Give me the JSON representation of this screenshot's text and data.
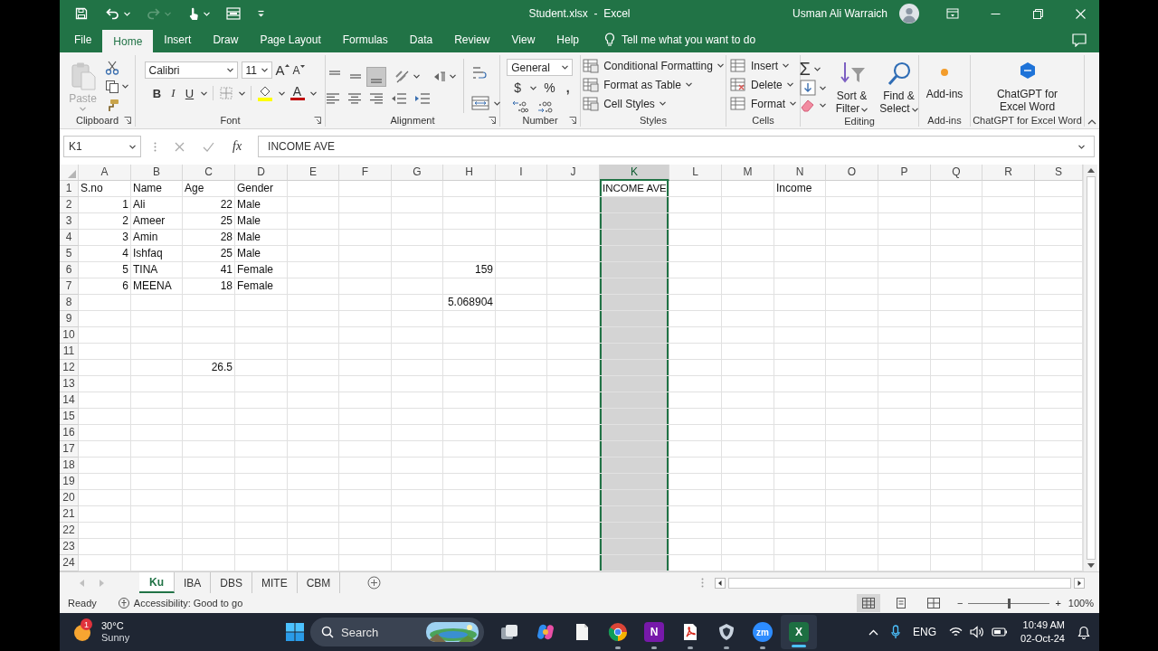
{
  "title_bar": {
    "title": "Student.xlsx  -  Excel",
    "user": "Usman Ali Warraich",
    "redo": {
      "disabled": true
    }
  },
  "ribbon_tabs": [
    {
      "label": "File",
      "selected": false
    },
    {
      "label": "Home",
      "selected": true
    },
    {
      "label": "Insert",
      "selected": false
    },
    {
      "label": "Draw",
      "selected": false
    },
    {
      "label": "Page Layout",
      "selected": false
    },
    {
      "label": "Formulas",
      "selected": false
    },
    {
      "label": "Data",
      "selected": false
    },
    {
      "label": "Review",
      "selected": false
    },
    {
      "label": "View",
      "selected": false
    },
    {
      "label": "Help",
      "selected": false
    }
  ],
  "tell_me": {
    "placeholder": "Tell me what you want to do"
  },
  "ribbon": {
    "groups": [
      {
        "kind": "clipboard",
        "label": "Clipboard",
        "paste": {
          "label": "Paste",
          "disabled": true
        }
      },
      {
        "kind": "font",
        "label": "Font",
        "font_name": "Calibri",
        "font_size": "11",
        "grow": "A",
        "shrink": "A",
        "styles": [
          "B",
          "I",
          "U"
        ],
        "font_color": "A"
      },
      {
        "kind": "alignment",
        "label": "Alignment",
        "align_buttons": [
          {
            "kind": "top",
            "selected": false
          },
          {
            "kind": "middle",
            "selected": false
          },
          {
            "kind": "bottom",
            "selected": true
          }
        ]
      },
      {
        "kind": "number",
        "label": "Number",
        "format": "General",
        "symbols": [
          "$",
          "%",
          ","
        ]
      },
      {
        "kind": "styles",
        "label": "Styles",
        "items": [
          "Conditional Formatting",
          "Format as Table",
          "Cell Styles"
        ]
      },
      {
        "kind": "cells",
        "label": "Cells",
        "items": [
          "Insert",
          "Delete",
          "Format"
        ]
      },
      {
        "kind": "editing",
        "label": "Editing",
        "autosum": "Σ",
        "items": [
          "Sort & Filter",
          "Find & Select"
        ]
      },
      {
        "kind": "addins",
        "label": "Add-ins",
        "button": "Add-ins"
      },
      {
        "kind": "app",
        "label": "ChatGPT for Excel Word",
        "button": "ChatGPT for Excel Word"
      }
    ]
  },
  "formula_bar": {
    "name_box": "K1",
    "function_label": "fx",
    "formula": "INCOME AVE"
  },
  "grid": {
    "columns": [
      {
        "label": "A",
        "selected": false
      },
      {
        "label": "B",
        "selected": false
      },
      {
        "label": "C",
        "selected": false
      },
      {
        "label": "D",
        "selected": false
      },
      {
        "label": "E",
        "selected": false
      },
      {
        "label": "F",
        "selected": false
      },
      {
        "label": "G",
        "selected": false
      },
      {
        "label": "H",
        "selected": false
      },
      {
        "label": "I",
        "selected": false
      },
      {
        "label": "J",
        "selected": false
      },
      {
        "label": "K",
        "selected": true
      },
      {
        "label": "L",
        "selected": false
      },
      {
        "label": "M",
        "selected": false
      },
      {
        "label": "N",
        "selected": false
      },
      {
        "label": "O",
        "selected": false
      },
      {
        "label": "P",
        "selected": false
      },
      {
        "label": "Q",
        "selected": false
      },
      {
        "label": "R",
        "selected": false
      },
      {
        "label": "S",
        "selected": false
      }
    ],
    "rows": [
      {
        "label": "1",
        "cells": {
          "A": {
            "text": "S.no",
            "kind": "text",
            "active": false
          },
          "B": {
            "text": "Name",
            "kind": "text",
            "active": false
          },
          "C": {
            "text": "Age",
            "kind": "text",
            "active": false
          },
          "D": {
            "text": "Gender",
            "kind": "text",
            "active": false
          },
          "K": {
            "text": "INCOME AVE",
            "kind": "text",
            "active": true
          },
          "N": {
            "text": "Income",
            "kind": "text",
            "active": false
          }
        }
      },
      {
        "label": "2",
        "cells": {
          "A": {
            "text": "1",
            "kind": "number",
            "active": false
          },
          "B": {
            "text": "Ali",
            "kind": "text",
            "active": false
          },
          "C": {
            "text": "22",
            "kind": "number",
            "active": false
          },
          "D": {
            "text": "Male",
            "kind": "text",
            "active": false
          }
        }
      },
      {
        "label": "3",
        "cells": {
          "A": {
            "text": "2",
            "kind": "number",
            "active": false
          },
          "B": {
            "text": "Ameer",
            "kind": "text",
            "active": false
          },
          "C": {
            "text": "25",
            "kind": "number",
            "active": false
          },
          "D": {
            "text": "Male",
            "kind": "text",
            "active": false
          }
        }
      },
      {
        "label": "4",
        "cells": {
          "A": {
            "text": "3",
            "kind": "number",
            "active": false
          },
          "B": {
            "text": "Amin",
            "kind": "text",
            "active": false
          },
          "C": {
            "text": "28",
            "kind": "number",
            "active": false
          },
          "D": {
            "text": "Male",
            "kind": "text",
            "active": false
          }
        }
      },
      {
        "label": "5",
        "cells": {
          "A": {
            "text": "4",
            "kind": "number",
            "active": false
          },
          "B": {
            "text": "Ishfaq",
            "kind": "text",
            "active": false
          },
          "C": {
            "text": "25",
            "kind": "number",
            "active": false
          },
          "D": {
            "text": "Male",
            "kind": "text",
            "active": false
          }
        }
      },
      {
        "label": "6",
        "cells": {
          "A": {
            "text": "5",
            "kind": "number",
            "active": false
          },
          "B": {
            "text": "TINA",
            "kind": "text",
            "active": false
          },
          "C": {
            "text": "41",
            "kind": "number",
            "active": false
          },
          "D": {
            "text": "Female",
            "kind": "text",
            "active": false
          },
          "H": {
            "text": "159",
            "kind": "number",
            "active": false
          }
        }
      },
      {
        "label": "7",
        "cells": {
          "A": {
            "text": "6",
            "kind": "number",
            "active": false
          },
          "B": {
            "text": "MEENA",
            "kind": "text",
            "active": false
          },
          "C": {
            "text": "18",
            "kind": "number",
            "active": false
          },
          "D": {
            "text": "Female",
            "kind": "text",
            "active": false
          }
        }
      },
      {
        "label": "8",
        "cells": {
          "H": {
            "text": "5.068904",
            "kind": "number",
            "active": false
          }
        }
      },
      {
        "label": "9"
      },
      {
        "label": "10"
      },
      {
        "label": "11"
      },
      {
        "label": "12",
        "cells": {
          "C": {
            "text": "26.5",
            "kind": "number",
            "active": false
          }
        }
      },
      {
        "label": "13"
      },
      {
        "label": "14"
      },
      {
        "label": "15"
      },
      {
        "label": "16"
      },
      {
        "label": "17"
      },
      {
        "label": "18"
      },
      {
        "label": "19"
      },
      {
        "label": "20"
      },
      {
        "label": "21"
      },
      {
        "label": "22"
      },
      {
        "label": "23"
      },
      {
        "label": "24"
      }
    ]
  },
  "sheet_tabs": [
    {
      "label": "Ku",
      "selected": true
    },
    {
      "label": "IBA",
      "selected": false
    },
    {
      "label": "DBS",
      "selected": false
    },
    {
      "label": "MITE",
      "selected": false
    },
    {
      "label": "CBM",
      "selected": false
    }
  ],
  "status_bar": {
    "mode": "Ready",
    "accessibility": "Accessibility: Good to go",
    "views": [
      {
        "kind": "normal",
        "selected": true
      },
      {
        "kind": "page_layout",
        "selected": false
      },
      {
        "kind": "page_break",
        "selected": false
      }
    ],
    "zoom": {
      "minus": "−",
      "plus": "+",
      "level": 0.5,
      "reading": "100%"
    }
  },
  "taskbar": {
    "weather": {
      "temperature": "30°C",
      "condition": "Sunny",
      "badge": "1"
    },
    "search": {
      "placeholder": "Search"
    },
    "apps": [
      {
        "kind": "task_view",
        "running": false,
        "active": false
      },
      {
        "kind": "copilot",
        "running": false,
        "active": false
      },
      {
        "kind": "file",
        "running": false,
        "active": false
      },
      {
        "kind": "chrome",
        "running": true,
        "active": false
      },
      {
        "kind": "onenote",
        "glyph": "N",
        "running": true,
        "active": false
      },
      {
        "kind": "pdf",
        "running": true,
        "active": false
      },
      {
        "kind": "shield",
        "running": true,
        "active": false
      },
      {
        "kind": "zoom",
        "glyph": "zm",
        "running": true,
        "active": false
      },
      {
        "kind": "excel",
        "glyph": "X",
        "running": true,
        "active": true
      }
    ],
    "tray": {
      "language": "ENG",
      "time": "10:49 AM",
      "date": "02-Oct-24"
    }
  }
}
